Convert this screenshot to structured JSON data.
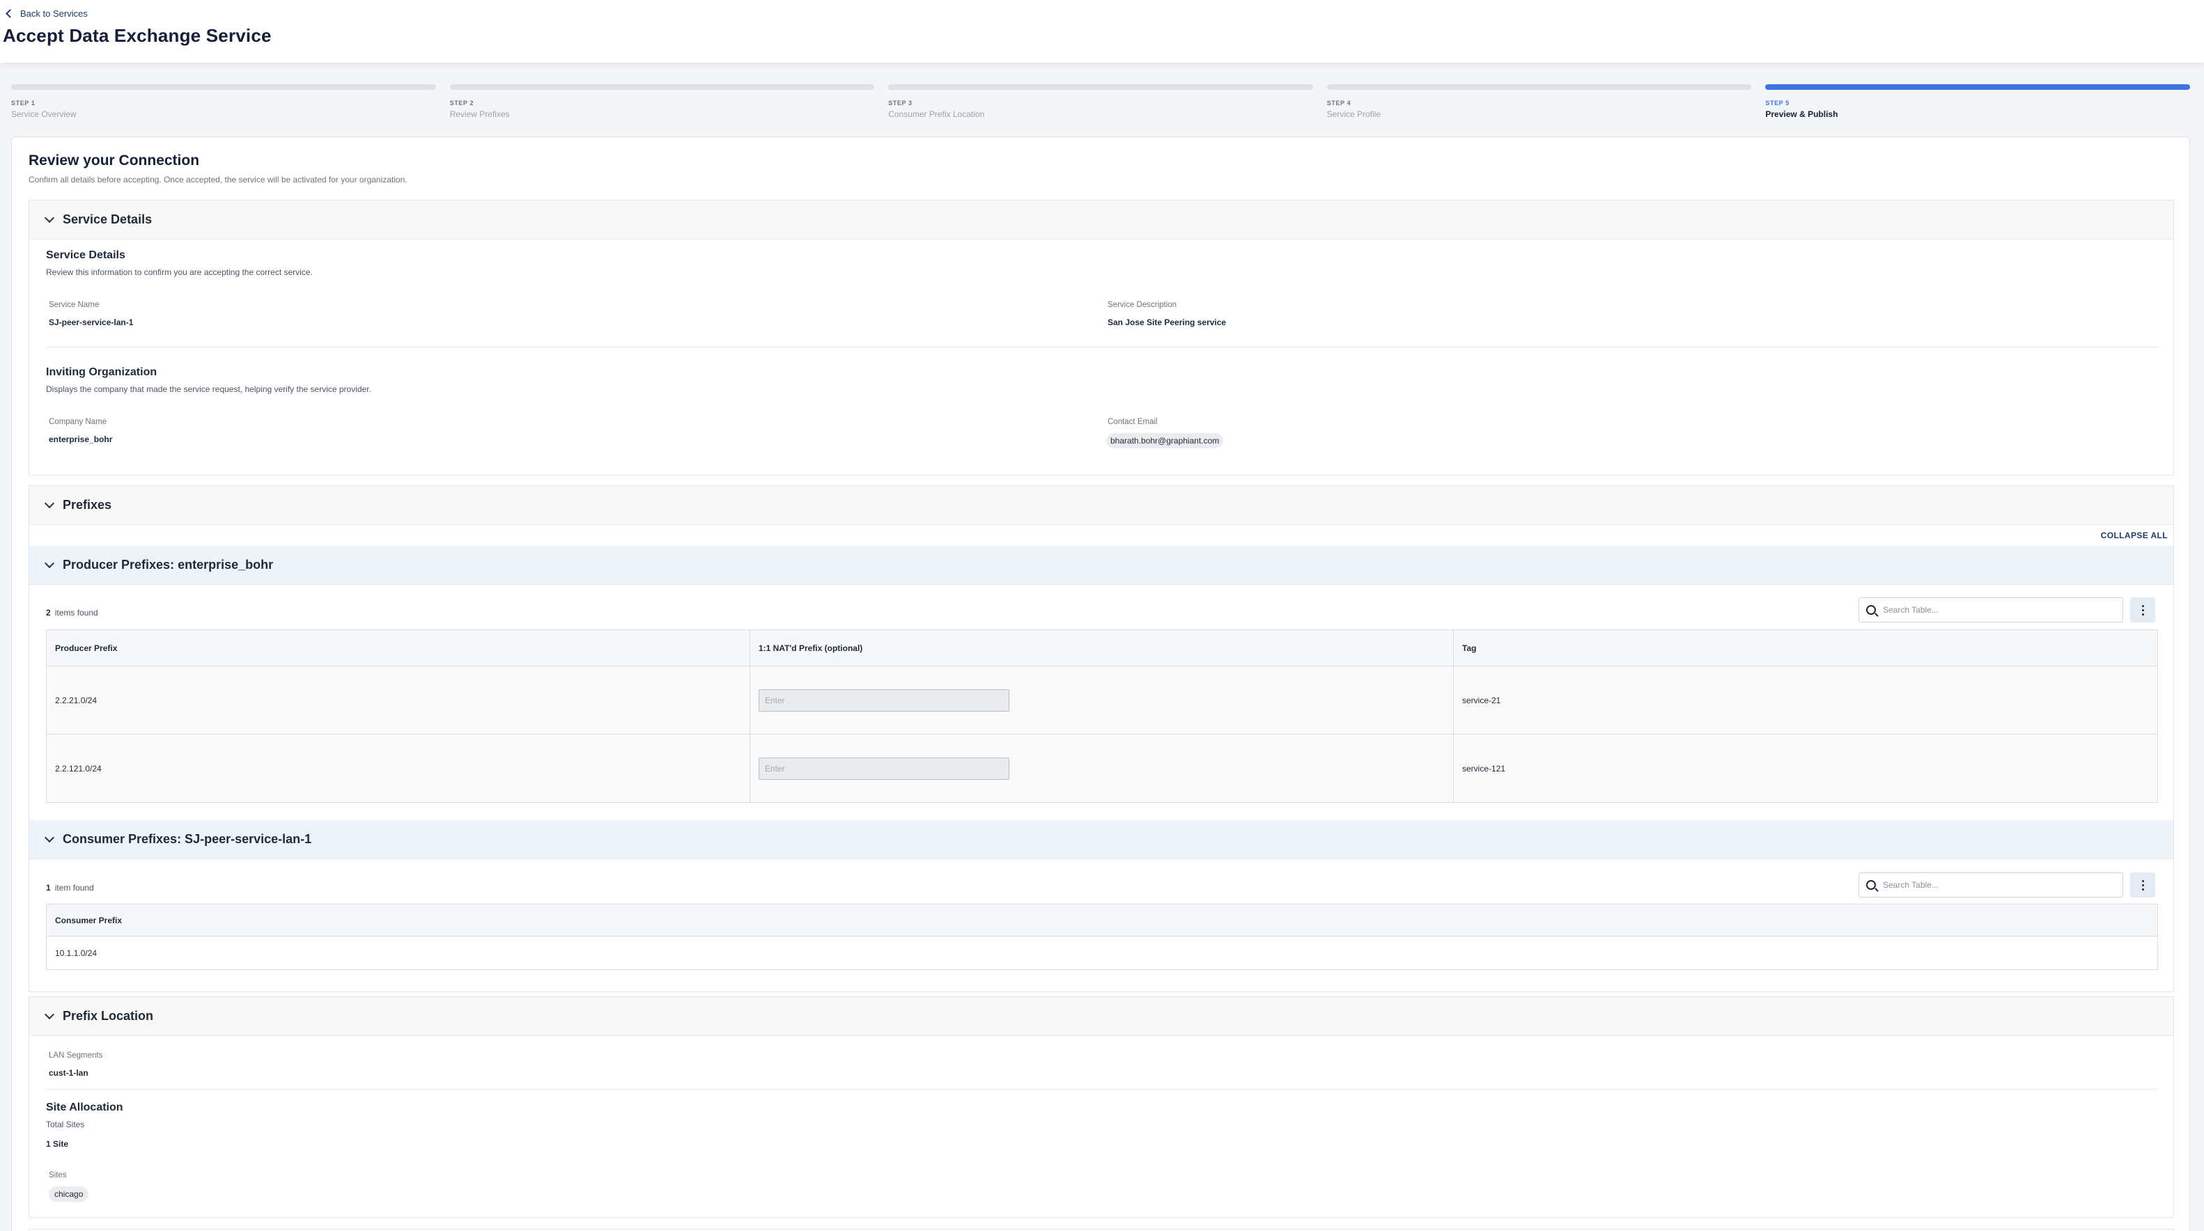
{
  "header": {
    "back_label": "Back to Services",
    "title": "Accept Data Exchange Service"
  },
  "stepper": {
    "steps": [
      {
        "num": "STEP 1",
        "name": "Service Overview"
      },
      {
        "num": "STEP 2",
        "name": "Review Prefixes"
      },
      {
        "num": "STEP 3",
        "name": "Consumer Prefix Location"
      },
      {
        "num": "STEP 4",
        "name": "Service Profile"
      },
      {
        "num": "STEP 5",
        "name": "Preview & Publish"
      }
    ],
    "active_step": 5
  },
  "review": {
    "title": "Review your Connection",
    "subtitle": "Confirm all details before accepting. Once accepted, the service will be activated for your organization."
  },
  "service_details": {
    "section_title": "Service Details",
    "sub_title": "Service Details",
    "sub_desc": "Review this information to confirm you are accepting the correct service.",
    "name_label": "Service Name",
    "name_value": "SJ-peer-service-lan-1",
    "desc_label": "Service Description",
    "desc_value": "San Jose Site Peering service",
    "org_title": "Inviting Organization",
    "org_desc": "Displays the company that made the service request, helping verify the service provider.",
    "company_label": "Company Name",
    "company_value": "enterprise_bohr",
    "email_label": "Contact Email",
    "email_value": "bharath.bohr@graphiant.com"
  },
  "prefixes": {
    "section_title": "Prefixes",
    "collapse_all": "COLLAPSE ALL",
    "producer": {
      "title": "Producer Prefixes: enterprise_bohr",
      "count": "2",
      "count_label": "items found",
      "search_placeholder": "Search Table...",
      "columns": [
        "Producer Prefix",
        "1:1 NAT'd Prefix (optional)",
        "Tag"
      ],
      "rows": [
        {
          "prefix": "2.2.21.0/24",
          "nat_placeholder": "Enter",
          "tag": "service-21"
        },
        {
          "prefix": "2.2.121.0/24",
          "nat_placeholder": "Enter",
          "tag": "service-121"
        }
      ]
    },
    "consumer": {
      "title": "Consumer Prefixes: SJ-peer-service-lan-1",
      "count": "1",
      "count_label": "item found",
      "search_placeholder": "Search Table...",
      "columns": [
        "Consumer Prefix"
      ],
      "rows": [
        {
          "prefix": "10.1.1.0/24"
        }
      ]
    }
  },
  "prefix_location": {
    "section_title": "Prefix Location",
    "lan_label": "LAN Segments",
    "lan_value": "cust-1-lan",
    "site_alloc_title": "Site Allocation",
    "total_sites_label": "Total Sites",
    "total_sites_value": "1 Site",
    "sites_label": "Sites",
    "site_chip": "chicago"
  }
}
